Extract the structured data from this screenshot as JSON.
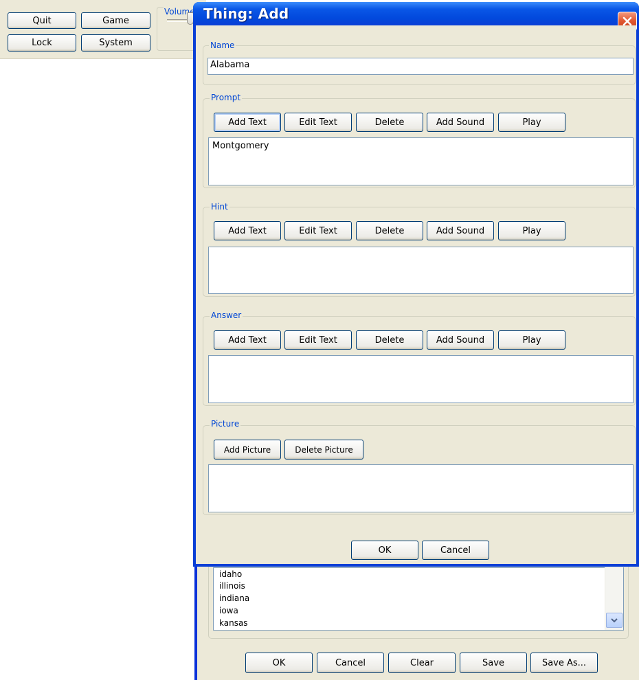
{
  "toolbar": {
    "quit_label": "Quit",
    "game_label": "Game",
    "lock_label": "Lock",
    "system_label": "System",
    "volume_label": "Volume"
  },
  "dialog": {
    "title": "Thing: Add",
    "name": {
      "label": "Name",
      "value": "Alabama"
    },
    "prompt": {
      "label": "Prompt",
      "add_text": "Add Text",
      "edit_text": "Edit Text",
      "delete": "Delete",
      "add_sound": "Add Sound",
      "play": "Play",
      "content": "Montgomery"
    },
    "hint": {
      "label": "Hint",
      "add_text": "Add Text",
      "edit_text": "Edit Text",
      "delete": "Delete",
      "add_sound": "Add Sound",
      "play": "Play",
      "content": ""
    },
    "answer": {
      "label": "Answer",
      "add_text": "Add Text",
      "edit_text": "Edit Text",
      "delete": "Delete",
      "add_sound": "Add Sound",
      "play": "Play",
      "content": ""
    },
    "picture": {
      "label": "Picture",
      "add_picture": "Add Picture",
      "delete_picture": "Delete Picture"
    },
    "ok_label": "OK",
    "cancel_label": "Cancel"
  },
  "main_window": {
    "list_items": [
      "idaho",
      "illinois",
      "indiana",
      "iowa",
      "kansas"
    ],
    "ok_label": "OK",
    "cancel_label": "Cancel",
    "clear_label": "Clear",
    "save_label": "Save",
    "save_as_label": "Save As..."
  },
  "colors": {
    "titlebar": "#0a57e7",
    "group_label": "#0046d5",
    "window_face": "#ece9d8",
    "close_button": "#e25a32"
  },
  "icons": {
    "close": "close-icon",
    "scroll_down": "chevron-down-icon"
  }
}
